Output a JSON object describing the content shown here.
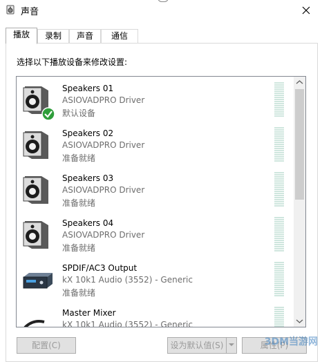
{
  "window": {
    "title": "声音"
  },
  "tabs": [
    {
      "label": "播放",
      "active": true
    },
    {
      "label": "录制",
      "active": false
    },
    {
      "label": "声音",
      "active": false
    },
    {
      "label": "通信",
      "active": false
    }
  ],
  "instruction": "选择以下播放设备来修改设置:",
  "devices": [
    {
      "name": "Speakers 01",
      "driver": "ASIOVADPRO Driver",
      "status": "默认设备",
      "icon": "speaker-icon",
      "default": true
    },
    {
      "name": "Speakers 02",
      "driver": "ASIOVADPRO Driver",
      "status": "准备就绪",
      "icon": "speaker-icon"
    },
    {
      "name": "Speakers 03",
      "driver": "ASIOVADPRO Driver",
      "status": "准备就绪",
      "icon": "speaker-icon"
    },
    {
      "name": "Speakers 04",
      "driver": "ASIOVADPRO Driver",
      "status": "准备就绪",
      "icon": "speaker-icon"
    },
    {
      "name": "SPDIF/AC3 Output",
      "driver": "kX 10k1 Audio (3552) - Generic",
      "status": "准备就绪",
      "icon": "digital-output-icon"
    },
    {
      "name": "Master Mixer",
      "driver": "kX 10k1 Audio (3552) - Generic",
      "status": "",
      "icon": "mixer-icon"
    }
  ],
  "buttons": {
    "configure": "配置(C)",
    "set_default": "设为默认值(S)",
    "properties": "属性(P)"
  },
  "watermark": "3DM当游网"
}
